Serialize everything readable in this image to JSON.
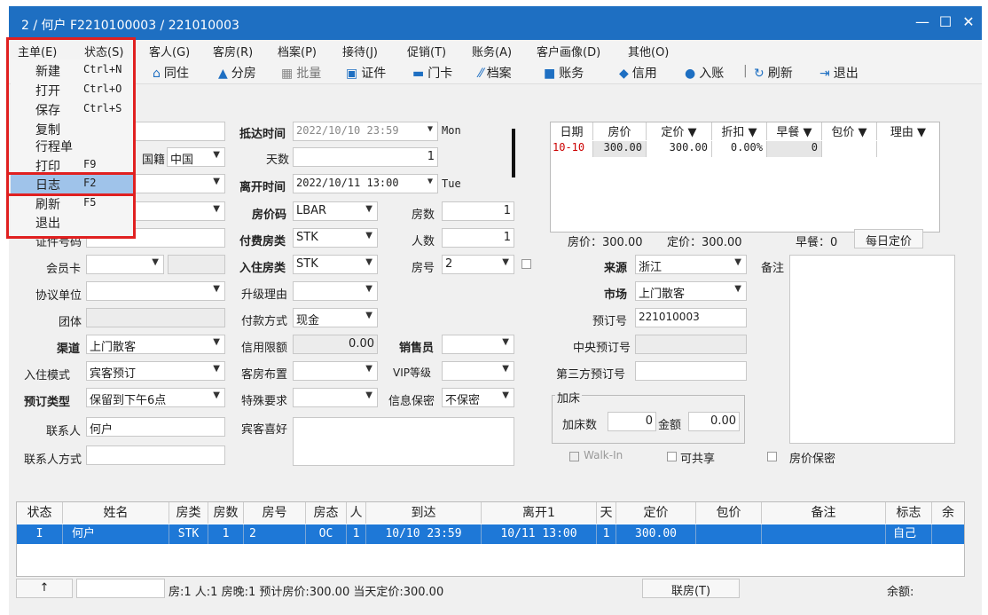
{
  "window": {
    "title": "2 / 何户 F2210100003 / 221010003"
  },
  "menubar": [
    "主单(E)",
    "状态(S)",
    "客人(G)",
    "客房(R)",
    "档案(P)",
    "接待(J)",
    "促销(T)",
    "账务(A)",
    "客户画像(D)",
    "其他(O)"
  ],
  "toolbar": [
    "同住",
    "分房",
    "批量",
    "证件",
    "门卡",
    "档案",
    "账务",
    "信用",
    "入账",
    "刷新",
    "退出"
  ],
  "dropdown": [
    {
      "label": "新建",
      "key": "Ctrl+N"
    },
    {
      "label": "打开",
      "key": "Ctrl+O"
    },
    {
      "label": "保存",
      "key": "Ctrl+S"
    },
    {
      "label": "复制",
      "key": ""
    },
    {
      "label": "行程单",
      "key": ""
    },
    {
      "label": "打印",
      "key": "F9"
    },
    {
      "label": "日志",
      "key": "F2"
    },
    {
      "label": "刷新",
      "key": "F5"
    },
    {
      "label": "退出",
      "key": ""
    }
  ],
  "form": {
    "nationality_label": "国籍",
    "nationality": "中国",
    "id_label": "证件号码",
    "member_label": "会员卡",
    "agreement_label": "协议单位",
    "group_label": "团体",
    "channel_label": "渠道",
    "channel": "上门散客",
    "checkin_mode_label": "入住模式",
    "checkin_mode": "宾客预订",
    "resv_type_label": "预订类型",
    "resv_type": "保留到下午6点",
    "contact_label": "联系人",
    "contact": "何户",
    "contact_method_label": "联系人方式",
    "arrival_label": "抵达时间",
    "arrival": "2022/10/10 23:59",
    "arrival_dow": "Mon",
    "days_label": "天数",
    "days": "1",
    "departure_label": "离开时间",
    "departure": "2022/10/11 13:00",
    "departure_dow": "Tue",
    "rate_code_label": "房价码",
    "rate_code": "LBAR",
    "rooms_label": "房数",
    "rooms": "1",
    "pay_room_label": "付费房类",
    "pay_room": "STK",
    "persons_label": "人数",
    "persons": "1",
    "stay_room_label": "入住房类",
    "stay_room": "STK",
    "room_no_label": "房号",
    "room_no": "2",
    "upgrade_label": "升级理由",
    "pay_method_label": "付款方式",
    "pay_method": "现金",
    "credit_label": "信用限额",
    "credit": "0.00",
    "sales_label": "销售员",
    "layout_label": "客房布置",
    "vip_label": "VIP等级",
    "special_label": "特殊要求",
    "privacy_label": "信息保密",
    "privacy": "不保密",
    "pref_label": "宾客喜好",
    "source_label": "来源",
    "source": "浙江",
    "market_label": "市场",
    "market": "上门散客",
    "resv_no_label": "预订号",
    "resv_no": "221010003",
    "central_label": "中央预订号",
    "third_label": "第三方预订号",
    "extra_bed_group": "加床",
    "extra_bed_label": "加床数",
    "extra_bed": "0",
    "amount_label": "金额",
    "amount": "0.00",
    "remark_label": "备注",
    "walkin_label": "Walk-In",
    "shareable_label": "可共享",
    "rate_secret_label": "房价保密"
  },
  "rate_grid": {
    "headers": [
      "日期",
      "房价",
      "定价 ▼",
      "折扣 ▼",
      "早餐 ▼",
      "包价 ▼",
      "理由 ▼"
    ],
    "row": [
      "10-10",
      "300.00",
      "300.00",
      "0.00%",
      "0",
      "",
      ""
    ],
    "summary_rate": "房价：300.00",
    "summary_fixed": "定价：300.00",
    "summary_breakfast": "早餐：0",
    "daily_button": "每日定价"
  },
  "guest_grid": {
    "headers": [
      "状态",
      "姓名",
      "房类",
      "房数",
      "房号",
      "房态",
      "人",
      "到达",
      "离开1",
      "天",
      "定价",
      "包价",
      "备注",
      "标志",
      "余"
    ],
    "row": [
      "I",
      "何户",
      "STK",
      "1",
      "2",
      "OC",
      "1",
      "10/10 23:59",
      "10/11 13:00",
      "1",
      "300.00",
      "",
      "",
      "自己",
      ""
    ]
  },
  "status": {
    "arrow": "↑",
    "text": "房:1  人:1  房晚:1  预计房价:300.00  当天定价:300.00",
    "link_button": "联房(T)",
    "balance": "余额:"
  }
}
